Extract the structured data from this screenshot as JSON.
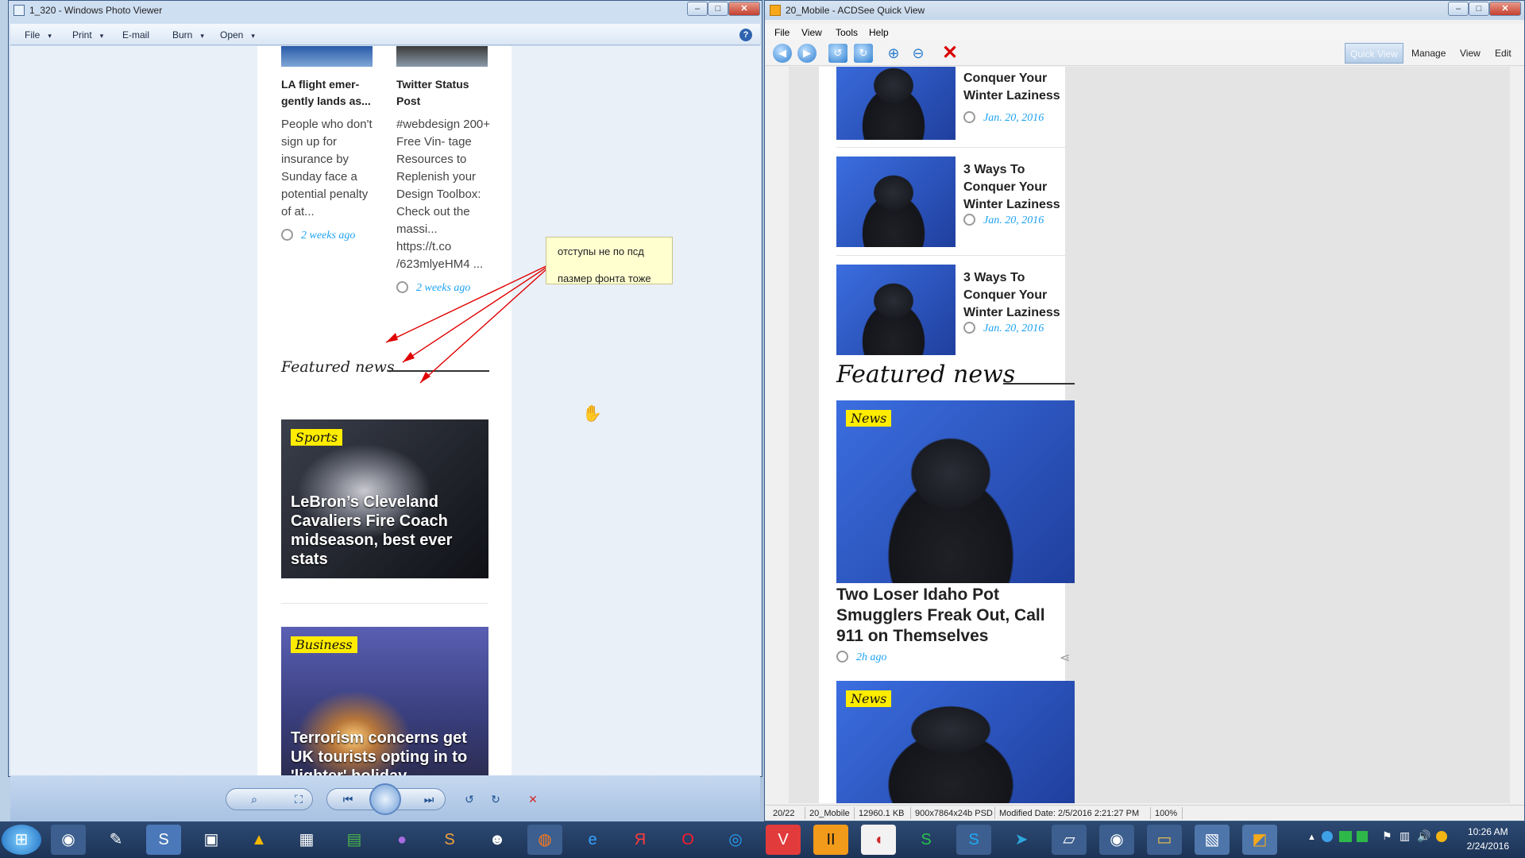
{
  "photo_viewer": {
    "title": "1_320 - Windows Photo Viewer",
    "menu": [
      {
        "label": "File",
        "caret": "▾"
      },
      {
        "label": "Print",
        "caret": "▾"
      },
      {
        "label": "E-mail",
        "caret": ""
      },
      {
        "label": "Burn",
        "caret": "▾"
      },
      {
        "label": "Open",
        "caret": "▾"
      }
    ],
    "articles": [
      {
        "title": "LA flight emer- gently lands as...",
        "body": "People who don't sign up for insurance by Sunday face a potential penalty of at...",
        "time": "2 weeks ago"
      },
      {
        "title": "Twitter Status Post",
        "body": "#webdesign 200+ Free Vin- tage Resources to Replenish your Design Toolbox: Check out the massi... https://t.co /623mlyeHM4 ...",
        "time": "2 weeks ago"
      }
    ],
    "section_title": "Featured news",
    "cards": [
      {
        "tag": "Sports",
        "title": "LeBron’s Cleveland Cavaliers Fire Coach midseason, best ever stats"
      },
      {
        "tag": "Business",
        "title": "Terrorism concerns get UK tourists opting in to 'lighter' holiday ..."
      }
    ],
    "annotation": {
      "line1": "отступы не по псд",
      "line2": "пазмер фонта тоже"
    }
  },
  "acdsee": {
    "title": "20_Mobile - ACDSee Quick View",
    "menu": [
      "File",
      "View",
      "Tools",
      "Help"
    ],
    "tabs": [
      "Quick View",
      "Manage",
      "View",
      "Edit"
    ],
    "list": [
      {
        "title": "Conquer Your Winter Laziness",
        "date": "Jan. 20, 2016"
      },
      {
        "title": "3 Ways To Conquer Your Winter Laziness",
        "date": "Jan. 20, 2016"
      },
      {
        "title": "3 Ways To Conquer Your Winter Laziness",
        "date": "Jan. 20, 2016"
      }
    ],
    "section_title": "Featured news",
    "featured": [
      {
        "tag": "News",
        "title": "Two Loser Idaho Pot Smugglers Freak Out, Call 911 on Themselves",
        "time": "2h ago"
      },
      {
        "tag": "News"
      }
    ],
    "status": {
      "index": "20/22",
      "name": "20_Mobile",
      "size": "12960.1 KB",
      "dims": "900x7864x24b PSD",
      "modified": "Modified Date: 2/5/2016 2:21:27 PM",
      "zoom": "100%"
    }
  },
  "taskbar": {
    "time": "10:26 AM",
    "date": "2/24/2016"
  },
  "colors": {
    "link": "#1da1f2",
    "tag": "#ffec00",
    "annotation_arrow": "#e00000"
  }
}
